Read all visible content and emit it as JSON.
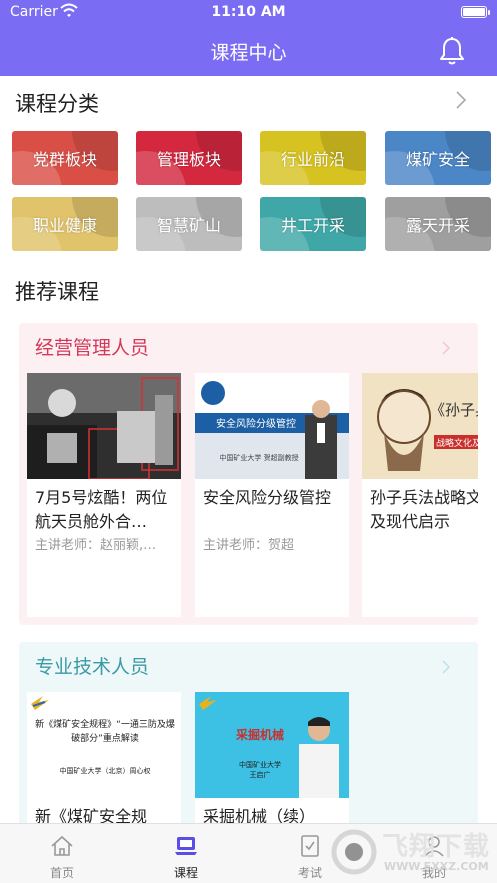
{
  "status_bar": {
    "carrier": "Carrier",
    "time": "11:10 AM"
  },
  "header": {
    "title": "课程中心"
  },
  "categories_section": {
    "title": "课程分类",
    "items": [
      {
        "label": "党群板块",
        "color": "#d94f46"
      },
      {
        "label": "管理板块",
        "color": "#d4283f"
      },
      {
        "label": "行业前沿",
        "color": "#d6c220"
      },
      {
        "label": "煤矿安全",
        "color": "#4b86c6"
      },
      {
        "label": "职业健康",
        "color": "#e0c36a"
      },
      {
        "label": "智慧矿山",
        "color": "#bdbdbd"
      },
      {
        "label": "井工开采",
        "color": "#3fa7a7"
      },
      {
        "label": "露天开采",
        "color": "#9f9f9f"
      }
    ]
  },
  "recommended": {
    "title": "推荐课程",
    "groups": [
      {
        "title": "经营管理人员",
        "title_color": "#d33a5a",
        "bg_color": "#fdf0f3",
        "courses": [
          {
            "title": "7月5号炫酷！两位航天员舱外合…",
            "teacher": "主讲老师：赵丽颖,…"
          },
          {
            "title": "安全风险分级管控",
            "teacher": "主讲老师：贺超",
            "thumb_text": "安全风险分级管控",
            "thumb_sub": "中国矿业大学  贺超副教授"
          },
          {
            "title": "孙子兵法战略文化及现代启示",
            "teacher": "",
            "thumb_text": "《孙子兵",
            "thumb_sub": "战略文化及现"
          }
        ]
      },
      {
        "title": "专业技术人员",
        "title_color": "#3a9aa6",
        "bg_color": "#eef8f9",
        "courses": [
          {
            "title": "新《煤矿安全规",
            "teacher": "",
            "thumb_text": "新《煤矿安全规程》“一通三防及爆破部分”重点解读",
            "thumb_sub": "中国矿业大学（北京）周心权"
          },
          {
            "title": "采掘机械（续）",
            "teacher": "",
            "thumb_text": "采掘机械",
            "thumb_sub": "中国矿业大学\n王启广"
          }
        ]
      }
    ]
  },
  "tabbar": {
    "items": [
      {
        "label": "首页",
        "icon": "home-icon"
      },
      {
        "label": "课程",
        "icon": "laptop-icon",
        "active": true
      },
      {
        "label": "考试",
        "icon": "exam-icon"
      },
      {
        "label": "我的",
        "icon": "user-icon"
      }
    ]
  },
  "watermark": {
    "text": "飞翔下载",
    "url_text": "WWW.FXXZ.COM"
  }
}
